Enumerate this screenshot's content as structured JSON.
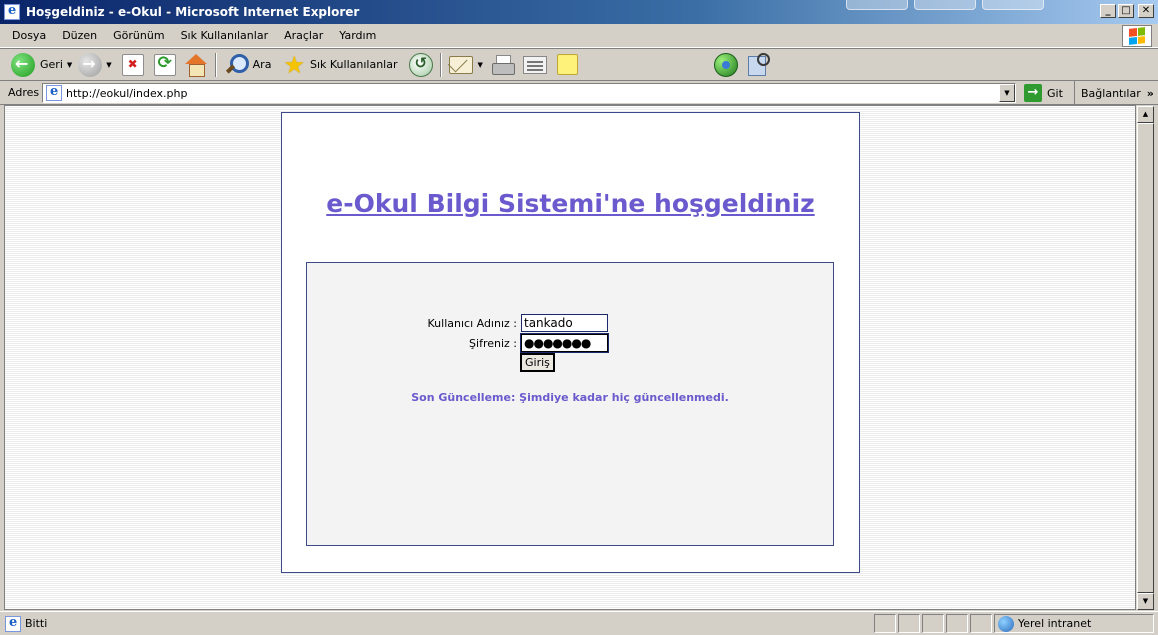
{
  "window": {
    "title": "Hoşgeldiniz - e-Okul  - Microsoft Internet Explorer",
    "minimize": "_",
    "maximize": "□",
    "close": "✕"
  },
  "menu": [
    "Dosya",
    "Düzen",
    "Görünüm",
    "Sık Kullanılanlar",
    "Araçlar",
    "Yardım"
  ],
  "toolbar": {
    "back_label": "Geri",
    "search_label": "Ara",
    "favorites_label": "Sık Kullanılanlar"
  },
  "address": {
    "label": "Adres",
    "url": "http://eokul/index.php",
    "go_label": "Git",
    "links_label": "Bağlantılar",
    "links_chevron": "»"
  },
  "page": {
    "title": "e-Okul Bilgi Sistemi'ne hoşgeldiniz",
    "username_label": "Kullanıcı Adınız :",
    "username_value": "tankado",
    "password_label": "Şifreniz :",
    "password_value": "●●●●●●●",
    "login_button": "Giriş",
    "last_update": "Son Güncelleme: Şimdiye kadar hiç güncellenmedi."
  },
  "status": {
    "text": "Bitti",
    "zone": "Yerel intranet"
  },
  "colors": {
    "title_color": "#6a5acd",
    "border_color": "#3d4a8a",
    "login_box_bg": "#f3f3f3"
  }
}
